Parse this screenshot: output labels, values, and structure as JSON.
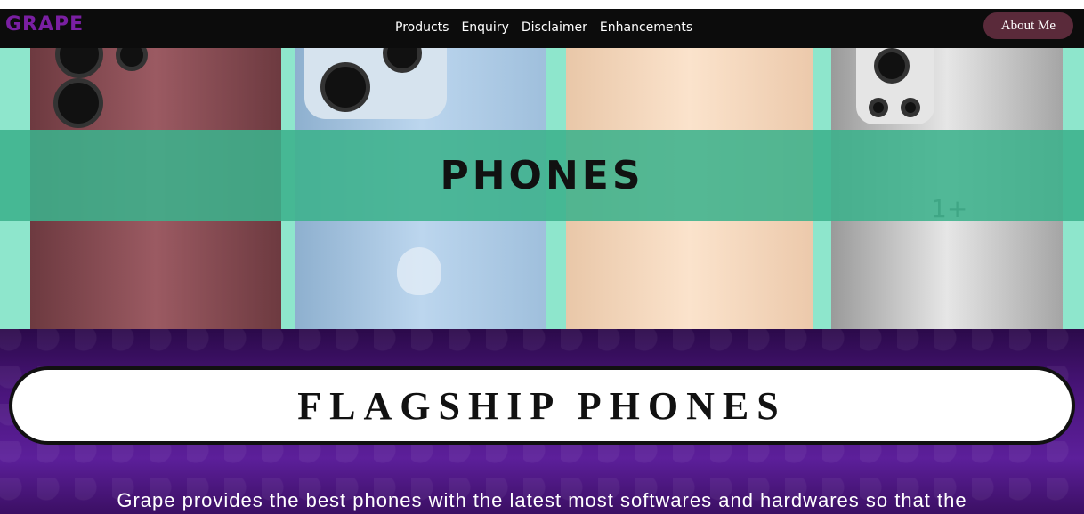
{
  "header": {
    "logo": "GRAPE",
    "nav": [
      "Products",
      "Enquiry",
      "Disclaimer",
      "Enhancements"
    ],
    "about_button": "About Me"
  },
  "hero": {
    "banner_title": "PHONES",
    "oneplus_mark": "1+"
  },
  "section": {
    "heading": "FLAGSHIP PHONES",
    "description": "Grape provides the best phones with the latest most softwares and hardwares so that the"
  },
  "colors": {
    "logo": "#7a1fa2",
    "banner": "#3cb28c",
    "hero_bg": "#8ee6cc",
    "section_bg": "#4a157c",
    "about_button": "#5a2a3a"
  }
}
